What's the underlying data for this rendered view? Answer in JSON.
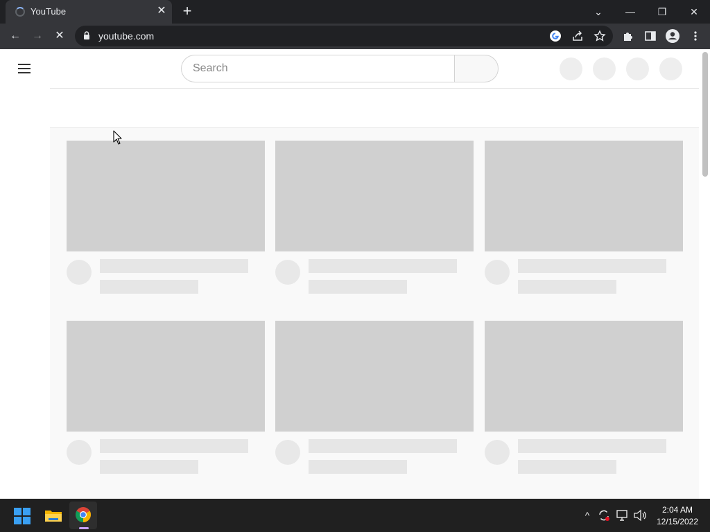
{
  "browser": {
    "tab": {
      "title": "YouTube",
      "close_label": "✕"
    },
    "new_tab_label": "+",
    "window_controls": {
      "menu": "⌄",
      "minimize": "—",
      "restore": "❐",
      "close": "✕"
    },
    "toolbar": {
      "back": "←",
      "forward": "→",
      "stop": "✕",
      "url": "youtube.com",
      "icons": [
        "google-lens-icon",
        "share-icon",
        "bookmark-star-icon",
        "extensions-icon",
        "side-panel-icon",
        "profile-icon",
        "menu-dots-icon"
      ]
    }
  },
  "youtube": {
    "search": {
      "placeholder": "Search",
      "value": ""
    },
    "header_placeholder_circles": 4,
    "video_placeholders": {
      "rows": 2,
      "columns": 3
    }
  },
  "taskbar": {
    "apps": [
      "start-button",
      "file-explorer",
      "google-chrome"
    ],
    "active_app": "google-chrome",
    "tray": {
      "chevron": "^",
      "time": "2:04 AM",
      "date": "12/15/2022"
    }
  },
  "colors": {
    "titlebar": "#202124",
    "toolbar": "#35363a",
    "skeleton_thumb": "#d0d0d0",
    "skeleton_line": "#e6e6e6",
    "taskbar": "#202020"
  }
}
